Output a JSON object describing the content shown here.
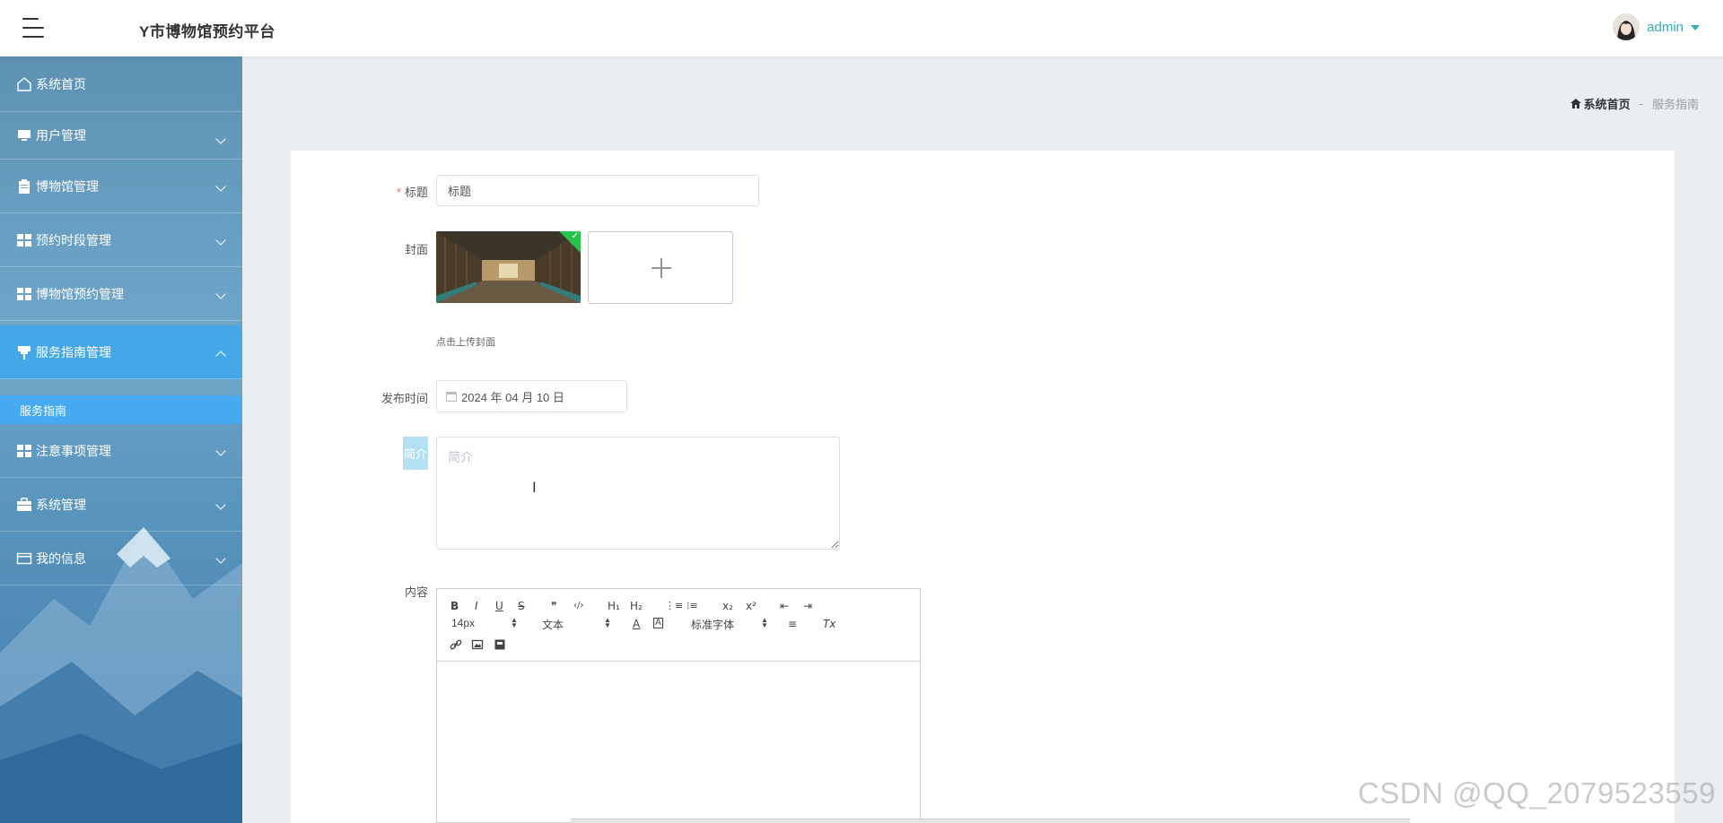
{
  "header": {
    "title": "Y市博物馆预约平台",
    "username": "admin"
  },
  "sidebar": {
    "items": [
      {
        "label": "系统首页",
        "icon": "home-icon"
      },
      {
        "label": "用户管理",
        "icon": "monitor-icon"
      },
      {
        "label": "博物馆管理",
        "icon": "clipboard-icon"
      },
      {
        "label": "预约时段管理",
        "icon": "grid-icon"
      },
      {
        "label": "博物馆预约管理",
        "icon": "grid-icon"
      },
      {
        "label": "服务指南管理",
        "icon": "pin-icon"
      },
      {
        "label": "注意事项管理",
        "icon": "grid-icon"
      },
      {
        "label": "系统管理",
        "icon": "briefcase-icon"
      },
      {
        "label": "我的信息",
        "icon": "card-icon"
      }
    ],
    "submenu": {
      "label": "服务指南"
    }
  },
  "breadcrumb": {
    "home": "系统首页",
    "separator": "-",
    "current": "服务指南"
  },
  "form": {
    "title": {
      "label": "标题",
      "required_mark": "*",
      "value": "标题"
    },
    "cover": {
      "label": "封面",
      "tip": "点击上传封面"
    },
    "publish_time": {
      "label": "发布时间",
      "value": "2024 年 04 月 10 日"
    },
    "intro": {
      "label": "简介",
      "placeholder": "简介"
    },
    "content": {
      "label": "内容"
    }
  },
  "editor_toolbar": {
    "bold": "B",
    "italic": "I",
    "underline": "U",
    "strike": "S",
    "quote": "❞",
    "code": "‹/›",
    "h1": "H₁",
    "h2": "H₂",
    "ordered_list": "⋮≡",
    "bullet_list": "⁝≡",
    "subscript": "x₂",
    "superscript": "x²",
    "outdent": "⇤",
    "indent": "⇥",
    "font_size": "14px",
    "header_style": "文本",
    "font_family": "标准字体",
    "color": "A",
    "background": "A",
    "align": "≡",
    "clean": "Tx",
    "link": "🔗",
    "image": "▣",
    "video": "▤"
  },
  "watermark": "CSDN @QQ_2079523559",
  "colors": {
    "accent": "#2fb0b8",
    "menu_active": "#44a8e8",
    "required": "#f56c6c"
  }
}
